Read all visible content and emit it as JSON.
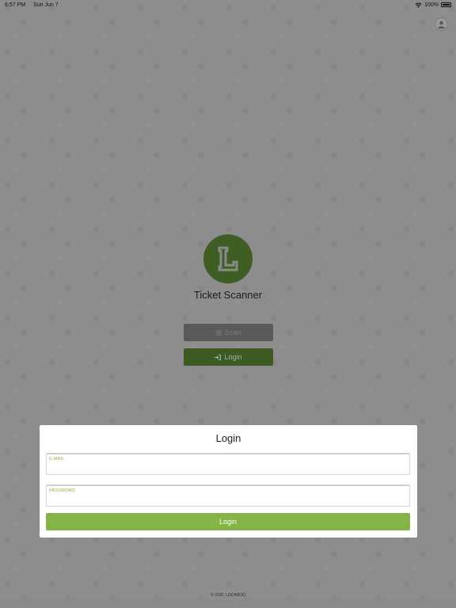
{
  "statusbar": {
    "time": "6:57 PM",
    "date": "Sun Jun 7",
    "battery": "100%"
  },
  "app": {
    "title": "Ticket Scanner"
  },
  "buttons": {
    "scan_label": "Scan",
    "login_label": "Login"
  },
  "modal": {
    "title": "Login",
    "email_label": "E-MAIL",
    "email_value": "",
    "password_label": "PASSWORD",
    "password_value": "",
    "submit_label": "Login"
  },
  "footer": {
    "text": "© 2020, LOCABOO"
  },
  "colors": {
    "brand_green": "#84b446",
    "dark_green": "#3c5a22",
    "overlay_gray": "#8d8d8d"
  },
  "icons": {
    "user": "user-icon",
    "scan": "qr-icon",
    "login": "sign-in-icon",
    "logo": "l-logo-icon"
  }
}
